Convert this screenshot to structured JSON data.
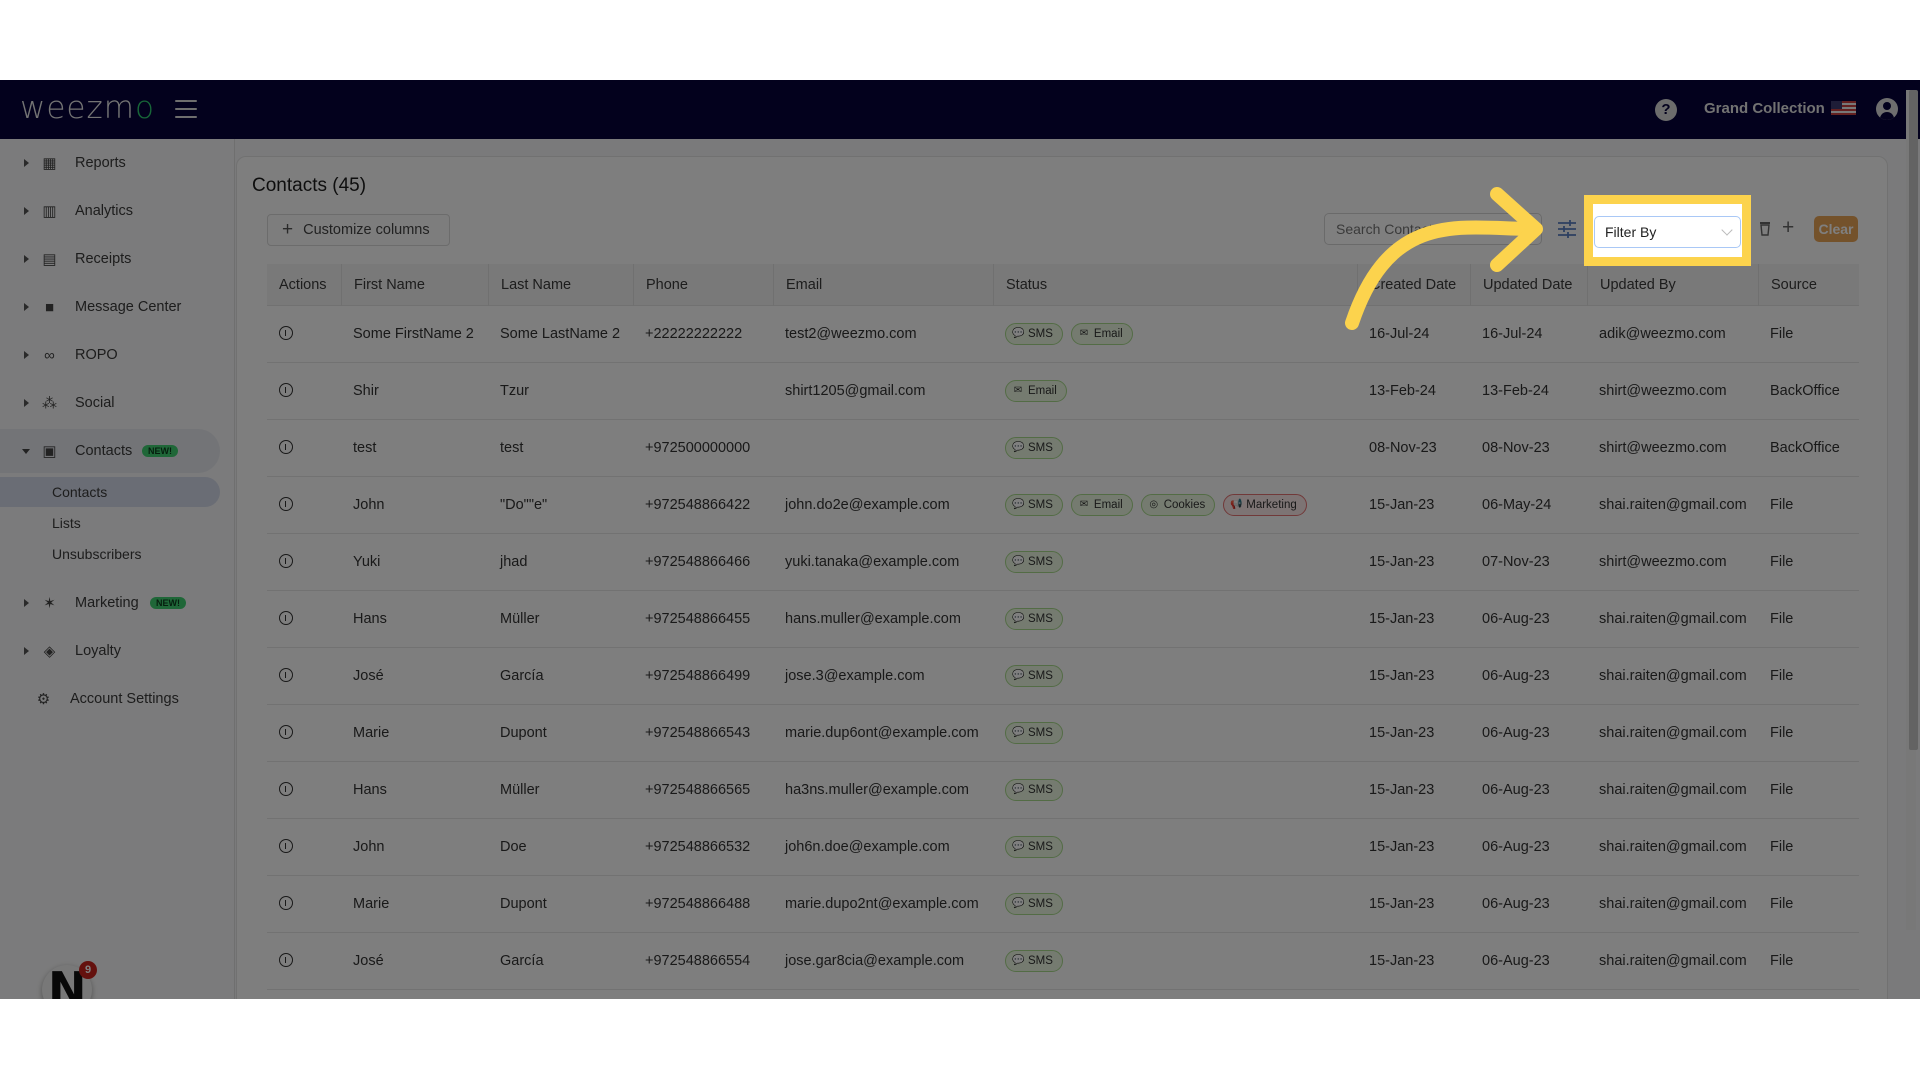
{
  "header": {
    "logo": "weezmo",
    "account_name": "Grand Collection",
    "icons": {
      "menu": "hamburger-icon",
      "help": "question-circle-icon",
      "flag": "us-flag-icon",
      "user": "user-circle-icon"
    }
  },
  "sidebar": {
    "items": [
      {
        "label": "Reports",
        "icon": "dashboard-icon"
      },
      {
        "label": "Analytics",
        "icon": "bar-chart-icon"
      },
      {
        "label": "Receipts",
        "icon": "receipt-icon"
      },
      {
        "label": "Message Center",
        "icon": "chat-bubble-icon"
      },
      {
        "label": "ROPO",
        "icon": "infinity-icon"
      },
      {
        "label": "Social",
        "icon": "people-icon"
      },
      {
        "label": "Contacts",
        "icon": "contacts-icon",
        "badge": "NEW!"
      },
      {
        "label": "Marketing",
        "icon": "party-popper-icon",
        "badge": "NEW!"
      },
      {
        "label": "Loyalty",
        "icon": "tag-heart-icon"
      },
      {
        "label": "Account Settings",
        "icon": "gear-icon"
      }
    ],
    "contacts_sub": [
      "Contacts",
      "Lists",
      "Unsubscribers"
    ],
    "chat_badge_count": "9"
  },
  "main": {
    "title": "Contacts (45)",
    "customize_columns": "Customize columns",
    "search_placeholder": "Search Contact",
    "filter_by": "Filter By",
    "clear_label": "Clear",
    "columns": [
      "Actions",
      "First Name",
      "Last Name",
      "Phone",
      "Email",
      "Status",
      "Created Date",
      "Updated Date",
      "Updated By",
      "Source"
    ],
    "rows": [
      {
        "first": "Some FirstName 2",
        "last": "Some LastName 2",
        "phone": "+22222222222",
        "email": "test2@weezmo.com",
        "status": [
          "SMS",
          "Email"
        ],
        "created": "16-Jul-24",
        "updated": "16-Jul-24",
        "updated_by": "adik@weezmo.com",
        "source": "File"
      },
      {
        "first": "Shir",
        "last": "Tzur",
        "phone": "",
        "email": "shirt1205@gmail.com",
        "status": [
          "Email"
        ],
        "created": "13-Feb-24",
        "updated": "13-Feb-24",
        "updated_by": "shirt@weezmo.com",
        "source": "BackOffice"
      },
      {
        "first": "test",
        "last": "test",
        "phone": "+972500000000",
        "email": "",
        "status": [
          "SMS"
        ],
        "created": "08-Nov-23",
        "updated": "08-Nov-23",
        "updated_by": "shirt@weezmo.com",
        "source": "BackOffice"
      },
      {
        "first": "John",
        "last": "\"Do\"\"e\"",
        "phone": "+972548866422",
        "email": "john.do2e@example.com",
        "status": [
          "SMS",
          "Email",
          "Cookies",
          "Marketing"
        ],
        "created": "15-Jan-23",
        "updated": "06-May-24",
        "updated_by": "shai.raiten@gmail.com",
        "source": "File"
      },
      {
        "first": "Yuki",
        "last": "jhad",
        "phone": "+972548866466",
        "email": "yuki.tanaka@example.com",
        "status": [
          "SMS"
        ],
        "created": "15-Jan-23",
        "updated": "07-Nov-23",
        "updated_by": "shirt@weezmo.com",
        "source": "File"
      },
      {
        "first": "Hans",
        "last": "Müller",
        "phone": "+972548866455",
        "email": "hans.muller@example.com",
        "status": [
          "SMS"
        ],
        "created": "15-Jan-23",
        "updated": "06-Aug-23",
        "updated_by": "shai.raiten@gmail.com",
        "source": "File"
      },
      {
        "first": "José",
        "last": "García",
        "phone": "+972548866499",
        "email": "jose.3@example.com",
        "status": [
          "SMS"
        ],
        "created": "15-Jan-23",
        "updated": "06-Aug-23",
        "updated_by": "shai.raiten@gmail.com",
        "source": "File"
      },
      {
        "first": "Marie",
        "last": "Dupont",
        "phone": "+972548866543",
        "email": "marie.dup6ont@example.com",
        "status": [
          "SMS"
        ],
        "created": "15-Jan-23",
        "updated": "06-Aug-23",
        "updated_by": "shai.raiten@gmail.com",
        "source": "File"
      },
      {
        "first": "Hans",
        "last": "Müller",
        "phone": "+972548866565",
        "email": "ha3ns.muller@example.com",
        "status": [
          "SMS"
        ],
        "created": "15-Jan-23",
        "updated": "06-Aug-23",
        "updated_by": "shai.raiten@gmail.com",
        "source": "File"
      },
      {
        "first": "John",
        "last": "Doe",
        "phone": "+972548866532",
        "email": "joh6n.doe@example.com",
        "status": [
          "SMS"
        ],
        "created": "15-Jan-23",
        "updated": "06-Aug-23",
        "updated_by": "shai.raiten@gmail.com",
        "source": "File"
      },
      {
        "first": "Marie",
        "last": "Dupont",
        "phone": "+972548866488",
        "email": "marie.dupo2nt@example.com",
        "status": [
          "SMS"
        ],
        "created": "15-Jan-23",
        "updated": "06-Aug-23",
        "updated_by": "shai.raiten@gmail.com",
        "source": "File"
      },
      {
        "first": "José",
        "last": "García",
        "phone": "+972548866554",
        "email": "jose.gar8cia@example.com",
        "status": [
          "SMS"
        ],
        "created": "15-Jan-23",
        "updated": "06-Aug-23",
        "updated_by": "shai.raiten@gmail.com",
        "source": "File"
      }
    ]
  },
  "colors": {
    "header_bg": "#06033a",
    "highlight": "#fcd34d",
    "clear_button": "#e8a456",
    "badge_new": "#3ecf70",
    "chip_green_border": "#a7d98a",
    "chip_red_border": "#e27272"
  }
}
